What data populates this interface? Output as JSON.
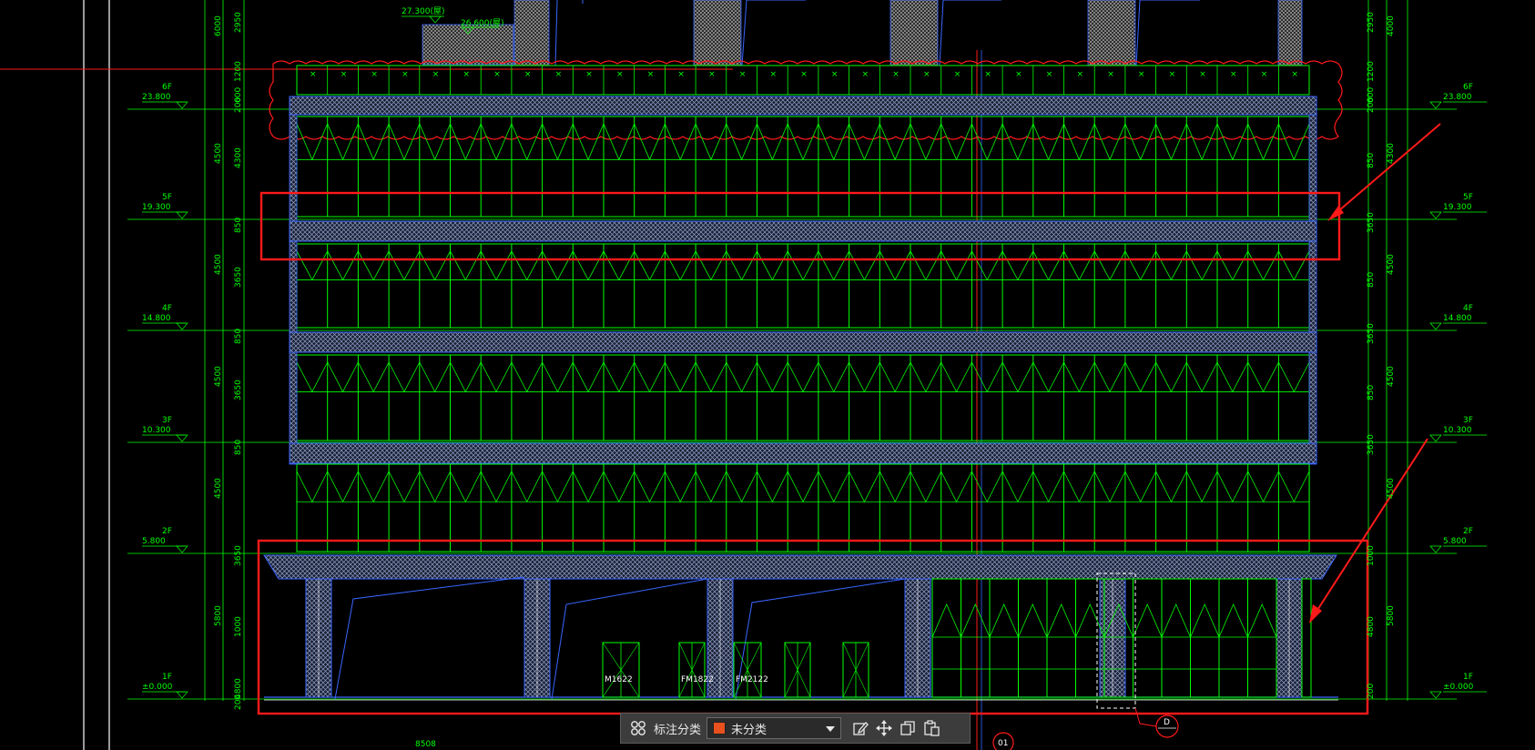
{
  "elevation_labels_left": [
    {
      "floor": "6F",
      "value": "23.800"
    },
    {
      "floor": "5F",
      "value": "19.300"
    },
    {
      "floor": "4F",
      "value": "14.800"
    },
    {
      "floor": "3F",
      "value": "10.300"
    },
    {
      "floor": "2F",
      "value": "5.800"
    },
    {
      "floor": "1F",
      "value": "±0.000"
    }
  ],
  "elevation_labels_right": [
    {
      "floor": "6F",
      "value": "23.800"
    },
    {
      "floor": "5F",
      "value": "19.300"
    },
    {
      "floor": "4F",
      "value": "14.800"
    },
    {
      "floor": "3F",
      "value": "10.300"
    },
    {
      "floor": "2F",
      "value": "5.800"
    },
    {
      "floor": "1F",
      "value": "±0.000"
    }
  ],
  "dims_left_outer": [
    "6000",
    "4500",
    "4500",
    "4500",
    "4500",
    "5800"
  ],
  "dims_left_inner": [
    "2950",
    "1200",
    "600",
    "200",
    "4300",
    "850",
    "3650",
    "850",
    "3650",
    "850",
    "3650",
    "1000",
    "4800",
    "200"
  ],
  "dims_right_outer": [
    "4000",
    "4300",
    "4500",
    "4500",
    "4500",
    "5800"
  ],
  "dims_right_inner": [
    "2950",
    "1200",
    "600",
    "200",
    "850",
    "3650",
    "850",
    "3650",
    "850",
    "3650",
    "1000",
    "4800",
    "200"
  ],
  "top_labels": {
    "roof_level": "27.300(屋)",
    "roof_level_2": "26.600(屋)"
  },
  "door_labels": [
    "M1622",
    "FM1822",
    "FM2122"
  ],
  "bottom_dim": "8508",
  "axis_markers": [
    "01",
    "D"
  ],
  "toolbar": {
    "label": "标注分类",
    "selected": "未分类",
    "swatch_color": "#e8501e"
  },
  "colors": {
    "green": "#00ff00",
    "blue": "#3a66ff",
    "red": "#ff1a1a",
    "white": "#ffffff",
    "hatch": "#8fa0c8"
  }
}
